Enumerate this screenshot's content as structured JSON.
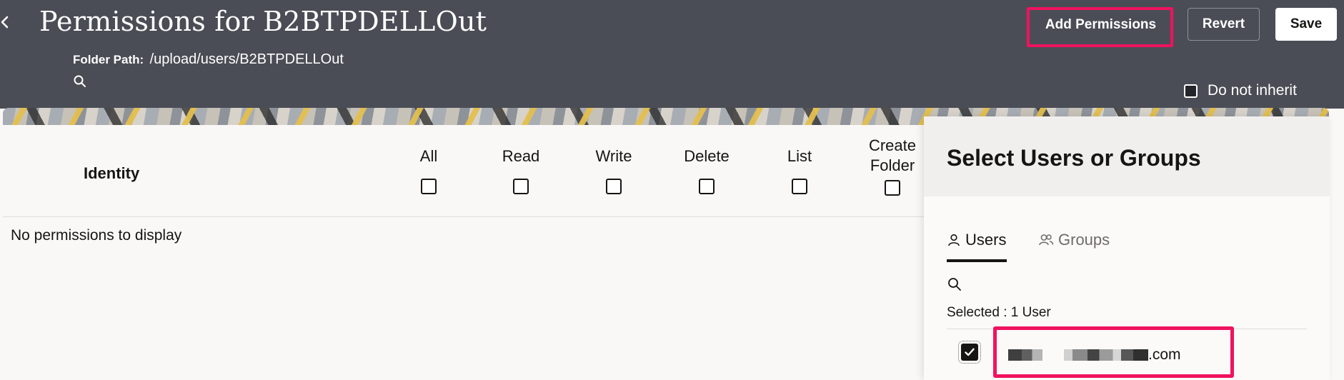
{
  "header": {
    "back_icon": "chevron-left-icon",
    "title": "Permissions for B2BTPDELLOut",
    "folder_path_label": "Folder Path:",
    "folder_path_value": "/upload/users/B2BTPDELLOut",
    "search_icon": "search-icon",
    "buttons": {
      "add_permissions": "Add Permissions",
      "revert": "Revert",
      "save": "Save"
    },
    "do_not_inherit": "Do not inherit",
    "highlight_color": "#f0135f"
  },
  "table": {
    "identity_header": "Identity",
    "columns": [
      "All",
      "Read",
      "Write",
      "Delete",
      "List"
    ],
    "create_folder_line1": "Create",
    "create_folder_line2": "Folder",
    "empty_message": "No permissions to display"
  },
  "panel": {
    "title": "Select Users or Groups",
    "tabs": [
      {
        "label": "Users",
        "icon": "user-icon",
        "active": true
      },
      {
        "label": "Groups",
        "icon": "users-group-icon",
        "active": false
      }
    ],
    "selected_label": "Selected : 1  User",
    "user_email_suffix": ".com",
    "user_checked": true
  },
  "colors": {
    "header_bg": "#4a4d55",
    "accent_pink": "#f0135f",
    "page_bg": "#f9f8f6"
  }
}
